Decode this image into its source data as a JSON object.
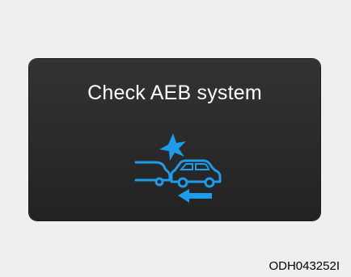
{
  "warning": {
    "message": "Check AEB system",
    "icon": "aeb-collision-warning-icon",
    "icon_color": "#1e9be9",
    "panel_color": "#2c2c2c",
    "text_color": "#ffffff"
  },
  "figure_code": "ODH043252I"
}
